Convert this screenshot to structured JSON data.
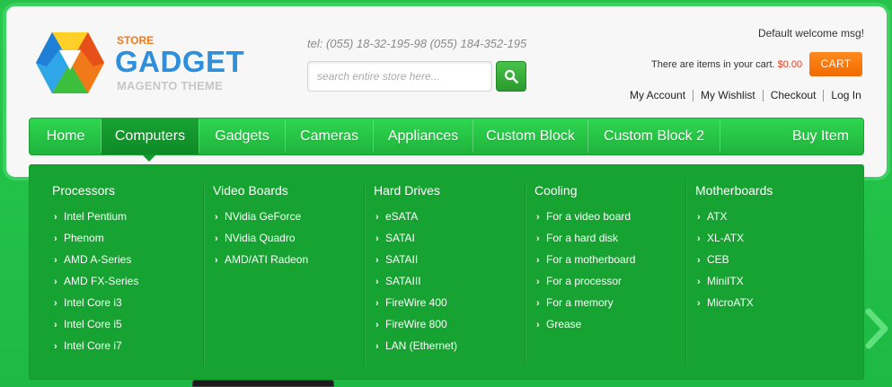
{
  "logo": {
    "store": "STORE",
    "gadget": "GADGET",
    "theme": "MAGENTO THEME"
  },
  "header": {
    "phone": "tel:  (055) 18-32-195-98  (055) 184-352-195",
    "search_placeholder": "search entire store here...",
    "welcome": "Default welcome msg!",
    "cart_prefix": "There are ",
    "cart_items_word": "items",
    "cart_suffix": " in your cart. ",
    "cart_amount": "$0.00",
    "cart_button": "CART",
    "links": [
      "My Account",
      "My Wishlist",
      "Checkout",
      "Log In"
    ]
  },
  "nav": {
    "items": [
      "Home",
      "Computers",
      "Gadgets",
      "Cameras",
      "Appliances",
      "Custom Block",
      "Custom Block 2",
      "Buy Item"
    ],
    "active": "Computers"
  },
  "dropdown": {
    "columns": [
      {
        "title": "Processors",
        "items": [
          "Intel Pentium",
          "Phenom",
          "AMD A-Series",
          "AMD FX-Series",
          "Intel Core i3",
          "Intel Core i5",
          "Intel Core i7"
        ]
      },
      {
        "title": "Video Boards",
        "items": [
          "NVidia GeForce",
          "NVidia Quadro",
          "AMD/ATI Radeon"
        ]
      },
      {
        "title": "Hard Drives",
        "items": [
          "eSATA",
          "SATAI",
          "SATAII",
          "SATAIII",
          "FireWire 400",
          "FireWire 800",
          "LAN (Ethernet)"
        ]
      },
      {
        "title": "Cooling",
        "items": [
          "For a video board",
          "For a hard disk",
          "For a motherboard",
          "For a processor",
          "For a memory",
          "Grease"
        ]
      },
      {
        "title": "Motherboards",
        "items": [
          "ATX",
          "XL-ATX",
          "CEB",
          "MiniITX",
          "MicroATX"
        ]
      }
    ]
  },
  "colors": {
    "brand_green": "#1fb33c",
    "accent_orange": "#f26a00",
    "logo_blue": "#2e8fdc",
    "price_red": "#e23b1a"
  },
  "icons": {
    "search": "magnifier-icon",
    "submenu": "chevron-right-icon",
    "slider_next": "chevron-right-icon"
  }
}
